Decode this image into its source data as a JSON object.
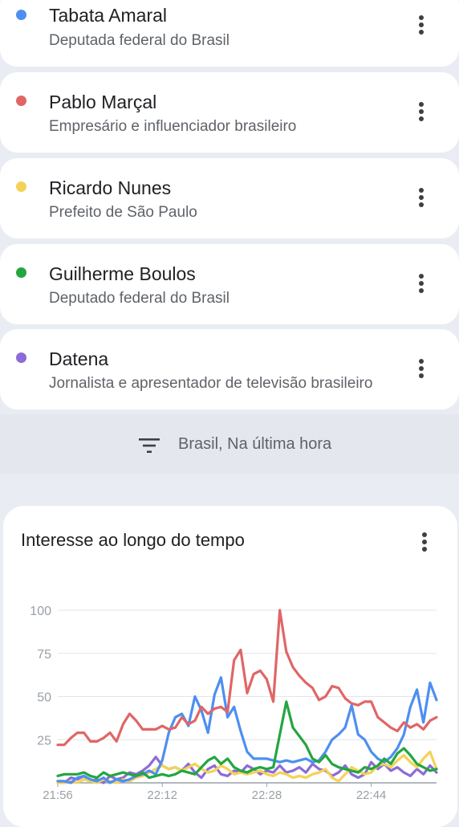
{
  "terms": [
    {
      "name": "Tabata Amaral",
      "description": "Deputada federal do Brasil",
      "color": "#4d8ff1"
    },
    {
      "name": "Pablo Marçal",
      "description": "Empresário e influenciador brasileiro",
      "color": "#e06666"
    },
    {
      "name": "Ricardo Nunes",
      "description": "Prefeito de São Paulo",
      "color": "#f4d256"
    },
    {
      "name": "Guilherme Boulos",
      "description": "Deputado federal do Brasil",
      "color": "#23a640"
    },
    {
      "name": "Datena",
      "description": "Jornalista e apresentador de televisão brasileiro",
      "color": "#8c6cd6"
    }
  ],
  "filter": {
    "label": "Brasil, Na última hora",
    "icon": "filter-icon"
  },
  "chart_card": {
    "title": "Interesse ao longo do tempo",
    "menu_icon": "more-vert-icon"
  },
  "chart_data": {
    "type": "line",
    "title": "Interesse ao longo do tempo",
    "xlabel": "",
    "ylabel": "",
    "ylim": [
      0,
      100
    ],
    "yticks": [
      0,
      25,
      50,
      75,
      100
    ],
    "x_tick_labels": [
      "21:56",
      "22:12",
      "22:28",
      "22:44"
    ],
    "x_tick_indices": [
      0,
      16,
      32,
      48
    ],
    "grid": true,
    "series": [
      {
        "name": "Pablo Marçal",
        "color": "#e06666",
        "values": [
          22,
          22,
          26,
          29,
          29,
          24,
          24,
          26,
          29,
          24,
          34,
          40,
          36,
          31,
          31,
          31,
          33,
          31,
          32,
          38,
          34,
          36,
          44,
          40,
          43,
          44,
          41,
          71,
          77,
          52,
          63,
          65,
          60,
          47,
          100,
          76,
          67,
          62,
          58,
          55,
          48,
          50,
          56,
          55,
          49,
          46,
          45,
          47,
          47,
          38,
          35,
          32,
          30,
          35,
          32,
          34,
          31,
          36,
          38
        ],
        "label_color": "#e06666"
      },
      {
        "name": "Tabata Amaral",
        "color": "#4d8ff1",
        "values": [
          1,
          1,
          0,
          3,
          4,
          2,
          1,
          3,
          0,
          2,
          1,
          2,
          4,
          5,
          7,
          5,
          13,
          29,
          38,
          40,
          33,
          50,
          42,
          29,
          51,
          61,
          38,
          44,
          30,
          18,
          14,
          14,
          14,
          13,
          12,
          13,
          12,
          13,
          14,
          12,
          13,
          18,
          25,
          28,
          32,
          45,
          28,
          25,
          18,
          14,
          12,
          15,
          20,
          28,
          44,
          54,
          35,
          58,
          48
        ]
      },
      {
        "name": "Ricardo Nunes",
        "color": "#f4d256",
        "values": [
          0,
          0,
          1,
          0,
          2,
          1,
          0,
          2,
          1,
          0,
          2,
          1,
          3,
          4,
          6,
          8,
          10,
          8,
          9,
          7,
          9,
          11,
          8,
          6,
          7,
          10,
          8,
          5,
          6,
          5,
          6,
          7,
          5,
          4,
          6,
          5,
          3,
          4,
          3,
          5,
          6,
          8,
          3,
          1,
          5,
          9,
          7,
          5,
          6,
          10,
          11,
          9,
          13,
          16,
          12,
          9,
          14,
          18,
          8
        ]
      },
      {
        "name": "Guilherme Boulos",
        "color": "#23a640",
        "values": [
          4,
          5,
          5,
          5,
          6,
          4,
          3,
          6,
          4,
          5,
          6,
          5,
          4,
          6,
          3,
          4,
          5,
          4,
          5,
          7,
          6,
          5,
          9,
          13,
          15,
          11,
          14,
          9,
          7,
          6,
          8,
          9,
          8,
          9,
          28,
          47,
          32,
          27,
          22,
          14,
          12,
          16,
          11,
          9,
          8,
          7,
          6,
          9,
          8,
          10,
          14,
          11,
          17,
          20,
          16,
          11,
          9,
          7,
          8
        ]
      },
      {
        "name": "Datena",
        "color": "#8c6cd6",
        "values": [
          1,
          0,
          3,
          2,
          4,
          1,
          2,
          0,
          4,
          2,
          3,
          6,
          5,
          7,
          10,
          15,
          10,
          8,
          9,
          7,
          11,
          6,
          3,
          8,
          10,
          5,
          4,
          7,
          6,
          10,
          8,
          5,
          7,
          6,
          10,
          6,
          7,
          9,
          6,
          11,
          8,
          7,
          4,
          6,
          10,
          5,
          3,
          5,
          12,
          8,
          11,
          7,
          9,
          6,
          4,
          8,
          5,
          10,
          6
        ]
      }
    ]
  }
}
